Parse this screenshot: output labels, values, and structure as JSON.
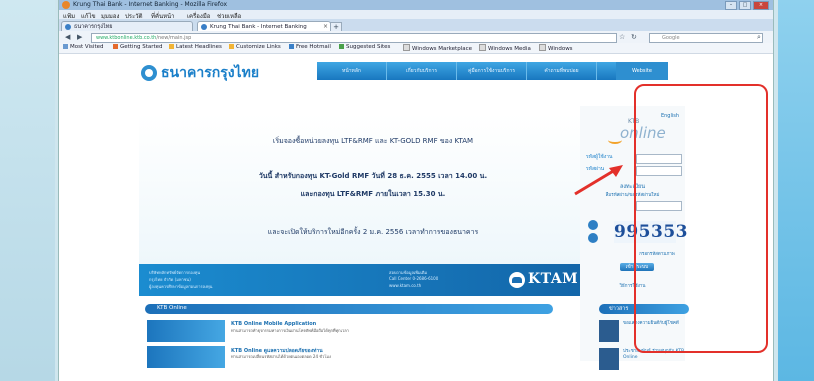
{
  "browser": {
    "title": "Krung Thai Bank - Internet Banking - Mozilla Firefox",
    "menu": [
      "แฟ้ม",
      "แก้ไข",
      "มุมมอง",
      "ประวัติ",
      "ที่คั่นหน้า",
      "เครื่องมือ",
      "ช่วยเหลือ"
    ],
    "tabs": [
      {
        "label": "ธนาคารกรุงไทย"
      },
      {
        "label": "Krung Thai Bank - Internet Banking"
      }
    ],
    "new_tab": "+",
    "url_host": "www.ktbonline.ktb.co.th",
    "url_path": "/new/main.jsp",
    "search_placeholder": "Google",
    "bookmarks": [
      "Most Visited",
      "Getting Started",
      "Latest Headlines",
      "Customize Links",
      "Free Hotmail",
      "Suggested Sites",
      "Windows Marketplace",
      "Windows Media",
      "Windows"
    ],
    "win_buttons": {
      "min": "–",
      "max": "□",
      "close": "×"
    }
  },
  "site": {
    "logo_text": "ธนาคารกรุงไทย",
    "nav": [
      "หน้าหลัก",
      "เกี่ยวกับบริการ",
      "คู่มือการใช้งานบริการ",
      "คำถามที่พบบ่อย",
      "ติดต่อเรา",
      "Website"
    ],
    "hero": {
      "line1": "เริ่มจองซื้อหน่วยลงทุน LTF&RMF และ KT-GOLD RMF ของ KTAM",
      "line2": "วันนี้ สำหรับกองทุน KT-Gold RMF วันที่ 28 ธ.ค. 2555 เวลา 14.00 น.",
      "line3": "และกองทุน LTF&RMF ภายในเวลา 15.30 น.",
      "line4": "และจะเปิดให้บริการใหม่อีกครั้ง 2 ม.ค. 2556 เวลาทำการของธนาคาร"
    },
    "banner": {
      "left_lines": [
        "บริษัทหลักทรัพย์จัดการกองทุน",
        "กรุงไทย จำกัด (มหาชน)",
        "ผู้ลงทุนควรศึกษาข้อมูลก่อนการลงทุน"
      ],
      "mid_lines": [
        "สอบถามข้อมูลเพิ่มเติม",
        "Call Center 0-2686-6100",
        "www.ktam.co.th"
      ],
      "ktam_name": "KTAM"
    },
    "login": {
      "eng_link": "English",
      "ktb_small": "KTB",
      "ktb_big": "online",
      "user_label": "รหัสผู้ใช้งาน",
      "pass_label": "รหัสผ่าน",
      "register_link": "ลงทะเบียน",
      "forgot_link": "ลืมรหัสผ่าน/ขอรหัสผ่านใหม่",
      "captcha_code": "995353",
      "captcha_hint": "กรอกรหัสตามภาพ",
      "login_button": "เข้าสู่ระบบ",
      "help_link": "วิธีการใช้งาน"
    },
    "news": {
      "section_title": "KTB Online",
      "items": [
        {
          "title": "KTB Online Mobile Application",
          "body": "ท่านสามารถทำธุรกรรมทางการเงินผ่านโทรศัพท์มือถือได้ทุกที่ทุกเวลา"
        },
        {
          "title": "KTB Online ดูแลความปลอดภัยของท่าน",
          "body": "ท่านสามารถเปลี่ยนรหัสผ่านได้ด้วยตนเองตลอด 24 ชั่วโมง"
        }
      ]
    },
    "side": {
      "section_title": "ข่าวสาร",
      "items": [
        {
          "text": "ขอแสดงความยินดีกับผู้โชคดี"
        },
        {
          "text": "ประชาสัมพันธ์ ร่วมสนุกกับ KTB Online"
        }
      ]
    }
  },
  "colors": {
    "accent": "#1a7fc9",
    "highlight": "#e3302a"
  }
}
